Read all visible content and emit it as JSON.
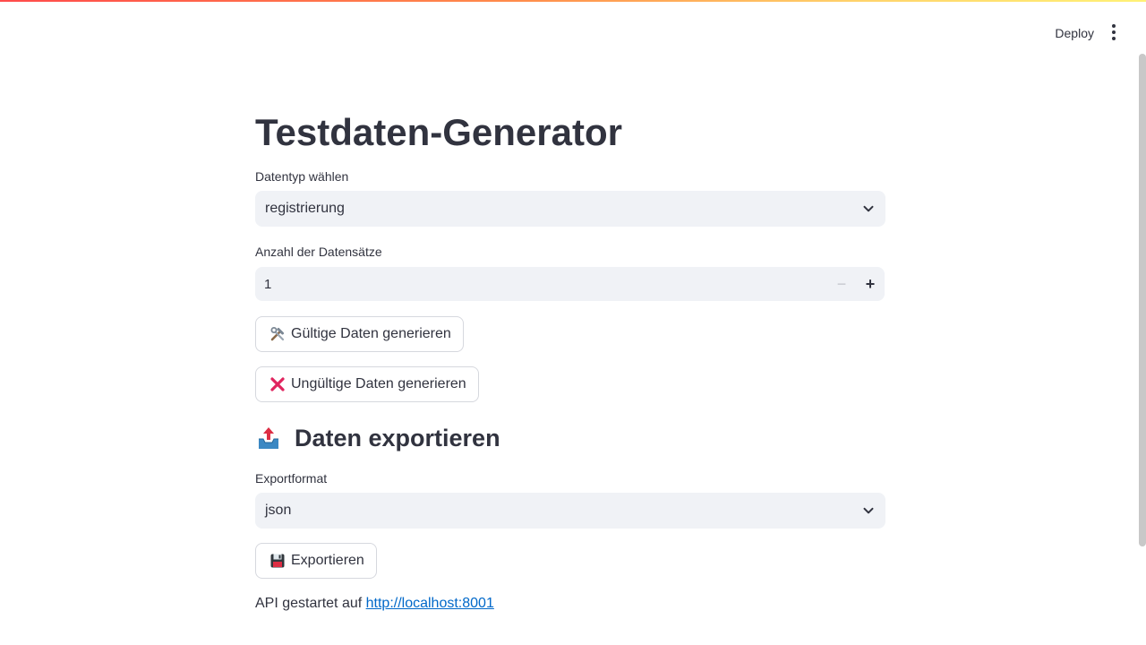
{
  "header": {
    "deploy_label": "Deploy",
    "menu_icon": "kebab-menu-icon"
  },
  "page": {
    "title": "Testdaten-Generator"
  },
  "datatype": {
    "label": "Datentyp wählen",
    "value": "registrierung"
  },
  "count": {
    "label": "Anzahl der Datensätze",
    "value": "1",
    "minus": "−",
    "plus": "+"
  },
  "buttons": {
    "valid": {
      "icon": "tools-icon",
      "label": "Gültige Daten generieren"
    },
    "invalid": {
      "icon": "cross-mark-icon",
      "label": "Ungültige Daten generieren"
    },
    "export": {
      "icon": "floppy-disk-icon",
      "label": "Exportieren"
    }
  },
  "export_section": {
    "icon": "outbox-tray-icon",
    "heading": "Daten exportieren",
    "format_label": "Exportformat",
    "format_value": "json"
  },
  "footer": {
    "api_prefix": "API gestartet auf ",
    "api_link": "http://localhost:8001"
  },
  "colors": {
    "accent_gradient_start": "#ff4b4b",
    "accent_gradient_end": "#fff176",
    "input_bg": "#f0f2f6",
    "link": "#0068c9",
    "text": "#31333f"
  }
}
